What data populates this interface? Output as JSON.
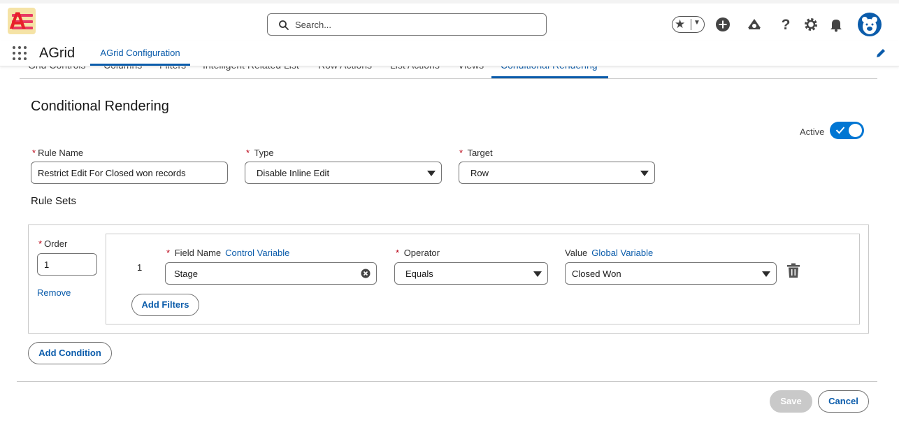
{
  "header": {
    "search_placeholder": "Search...",
    "icons": [
      "star-icon",
      "chevron-down-icon",
      "add-icon",
      "trailhead-icon",
      "help-icon",
      "settings-icon",
      "notification-icon",
      "avatar"
    ]
  },
  "appnav": {
    "app_name": "AGrid",
    "tab_label": "AGrid Configuration"
  },
  "subtabs": [
    {
      "label": "Grid Controls"
    },
    {
      "label": "Columns"
    },
    {
      "label": "Filters"
    },
    {
      "label": "Intelligent Related List"
    },
    {
      "label": "Row Actions"
    },
    {
      "label": "List Actions"
    },
    {
      "label": "Views"
    },
    {
      "label": "Conditional Rendering"
    }
  ],
  "form": {
    "title": "Conditional Rendering",
    "active_label": "Active",
    "rule_name_label": "Rule Name",
    "rule_name_value": "Restrict Edit For Closed won records",
    "type_label": "Type",
    "type_value": "Disable Inline Edit",
    "target_label": "Target",
    "target_value": "Row",
    "rule_sets_title": "Rule Sets"
  },
  "ruleset": {
    "order_label": "Order",
    "order_value": "1",
    "remove_label": "Remove",
    "row_number": "1",
    "field_name_label": "Field Name",
    "control_variable_link": "Control Variable",
    "field_name_value": "Stage",
    "operator_label": "Operator",
    "operator_value": "Equals",
    "value_label": "Value",
    "global_variable_link": "Global Variable",
    "value_value": "Closed Won",
    "add_filters_label": "Add Filters"
  },
  "footer": {
    "add_condition_label": "Add Condition",
    "save_label": "Save",
    "cancel_label": "Cancel"
  },
  "colors": {
    "brand": "#0b5cab",
    "toggle": "#0176d3",
    "required": "#ba0517"
  }
}
